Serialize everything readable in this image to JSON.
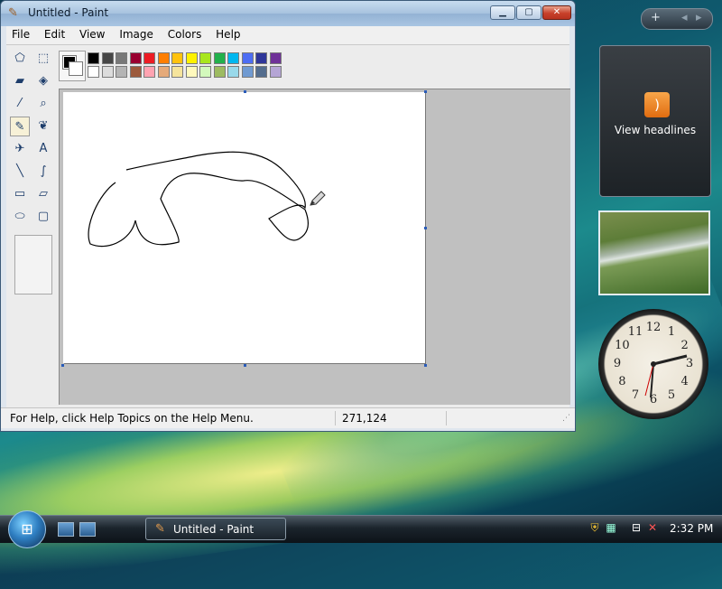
{
  "window": {
    "title": "Untitled - Paint",
    "caption_buttons": {
      "minimize": "▁",
      "maximize": "▢",
      "close": "✕"
    }
  },
  "menu": [
    "File",
    "Edit",
    "View",
    "Image",
    "Colors",
    "Help"
  ],
  "tools": [
    {
      "name": "free-form-select-icon",
      "glyph": "⬠"
    },
    {
      "name": "rectangle-select-icon",
      "glyph": "⬚"
    },
    {
      "name": "eraser-icon",
      "glyph": "▰"
    },
    {
      "name": "fill-bucket-icon",
      "glyph": "◈"
    },
    {
      "name": "color-picker-icon",
      "glyph": "⁄"
    },
    {
      "name": "magnifier-icon",
      "glyph": "⌕"
    },
    {
      "name": "pencil-icon",
      "glyph": "✎"
    },
    {
      "name": "brush-icon",
      "glyph": "❦"
    },
    {
      "name": "airbrush-icon",
      "glyph": "✈"
    },
    {
      "name": "text-icon",
      "glyph": "A"
    },
    {
      "name": "line-icon",
      "glyph": "╲"
    },
    {
      "name": "curve-icon",
      "glyph": "∫"
    },
    {
      "name": "rectangle-icon",
      "glyph": "▭"
    },
    {
      "name": "polygon-icon",
      "glyph": "▱"
    },
    {
      "name": "ellipse-icon",
      "glyph": "⬭"
    },
    {
      "name": "rounded-rectangle-icon",
      "glyph": "▢"
    }
  ],
  "palette": {
    "foreground": "#000000",
    "background": "#ffffff",
    "row1": [
      "#000000",
      "#464646",
      "#787878",
      "#990030",
      "#ed1c24",
      "#ff7e00",
      "#ffc20e",
      "#fff200",
      "#a8e61d",
      "#22b14c",
      "#00b7ef",
      "#4d6df3",
      "#2f3699",
      "#6f3198"
    ],
    "row2": [
      "#ffffff",
      "#dcdcdc",
      "#b4b4b4",
      "#9c5a3c",
      "#ffa3b1",
      "#e5aa7a",
      "#f5e49c",
      "#fff9bd",
      "#d3f9bc",
      "#9dbb61",
      "#99d9ea",
      "#709ad1",
      "#546d8e",
      "#b5a5d5"
    ]
  },
  "status": {
    "help_text": "For Help, click Help Topics on the Help Menu.",
    "coords": "271,124"
  },
  "gadgets": {
    "toolbar_add": "+",
    "toolbar_prev": "◂",
    "toolbar_next": "▸",
    "rss_glyph": ")",
    "rss_label": "View headlines",
    "clock_numbers": [
      "12",
      "1",
      "2",
      "3",
      "4",
      "5",
      "6",
      "7",
      "8",
      "9",
      "10",
      "11"
    ]
  },
  "taskbar": {
    "start_glyph": "⊞",
    "task_label": "Untitled - Paint",
    "time": "2:32 PM"
  }
}
